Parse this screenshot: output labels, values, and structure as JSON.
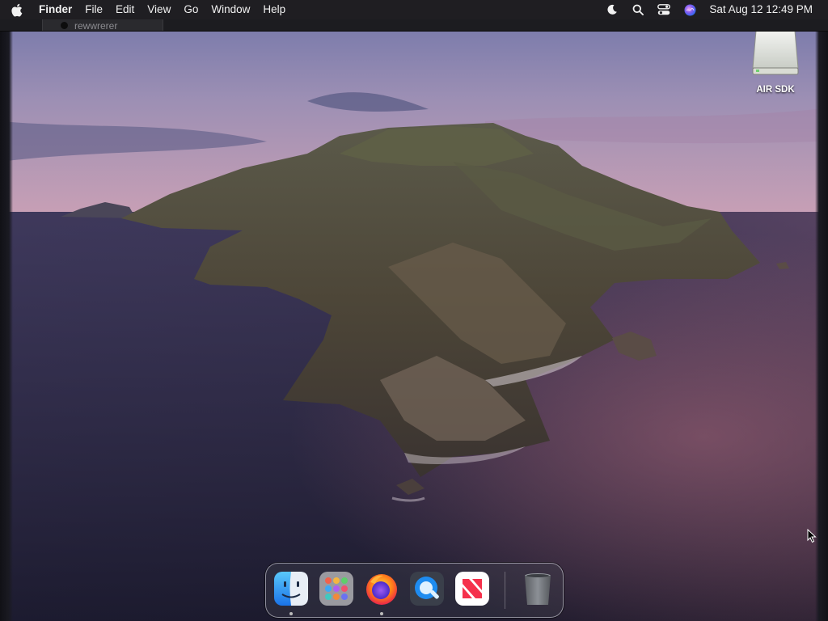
{
  "menubar": {
    "apple_icon": "apple-logo-icon",
    "app_name": "Finder",
    "menus": [
      "File",
      "Edit",
      "View",
      "Go",
      "Window",
      "Help"
    ],
    "status_icons": [
      "moon-icon",
      "search-icon",
      "control-center-icon",
      "siri-icon"
    ],
    "clock": "Sat Aug 12  12:49 PM"
  },
  "background_window": {
    "tab_title": "rewwrerer"
  },
  "desktop": {
    "icons": [
      {
        "label": "AIR SDK",
        "icon": "external-disk-icon"
      }
    ]
  },
  "dock": {
    "apps": [
      {
        "name": "Finder",
        "icon": "finder-icon",
        "running": true
      },
      {
        "name": "Launchpad",
        "icon": "launchpad-icon",
        "running": false
      },
      {
        "name": "Firefox",
        "icon": "firefox-icon",
        "running": true
      },
      {
        "name": "QuickTime Player",
        "icon": "quicktime-icon",
        "running": false
      },
      {
        "name": "News",
        "icon": "news-icon",
        "running": false
      }
    ],
    "trash": {
      "name": "Trash",
      "icon": "trash-icon"
    }
  },
  "colors": {
    "menubar_bg": "#1f1e22",
    "menubar_text": "#f2f2f2",
    "sky_top": "#7a7eae",
    "sky_horizon": "#c49ab4",
    "sea": "#3a3454"
  }
}
